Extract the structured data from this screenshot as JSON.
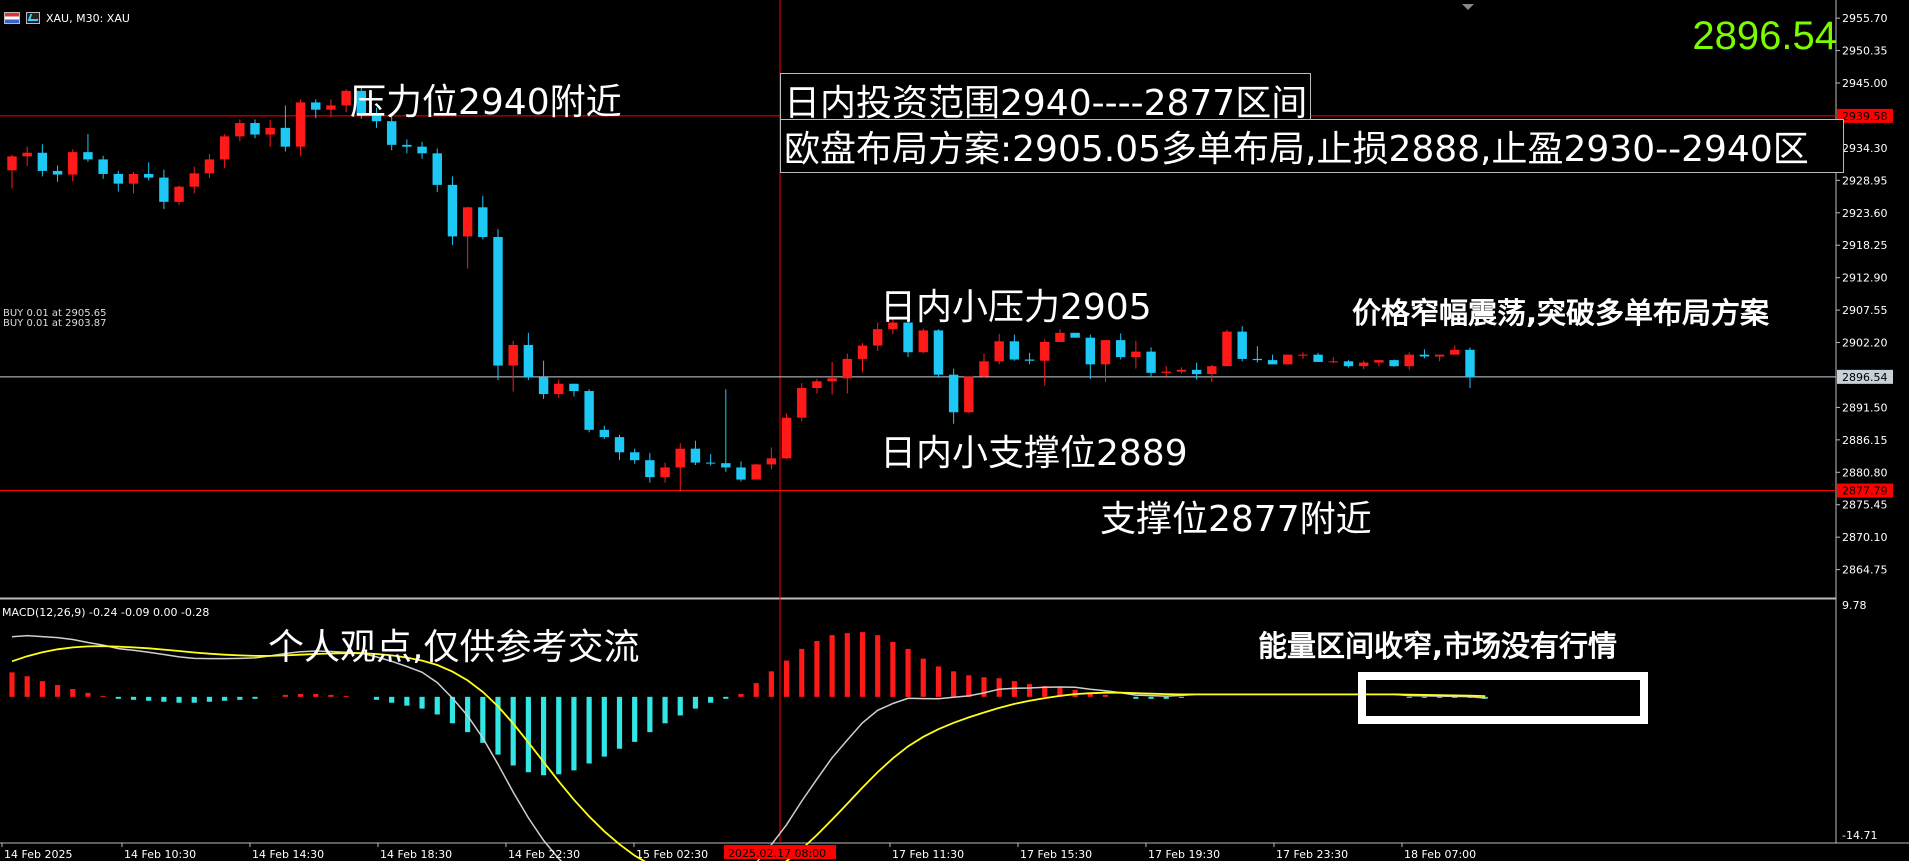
{
  "header": {
    "symbol_text": "XAU, M30:  XAU",
    "icons": [
      "table-icon",
      "chart-icon"
    ]
  },
  "current_price": "2896.54",
  "colors": {
    "background": "#000000",
    "bull_candle": "#ff1a1a",
    "bear_candle": "#1ec8f5",
    "grid_text": "#ffffff",
    "macd_line": "#cfcfcf",
    "signal_line": "#ffff1a",
    "hist_positive": "#ff1a1a",
    "hist_negative": "#33e6e6",
    "level_line": "#ff0000",
    "price_badge": "#c8d0d8",
    "price_big": "#7cfc00"
  },
  "annotations": {
    "resistance": "压力位2940附近",
    "range": "日内投资范围2940----2877区间",
    "plan": "欧盘布局方案:2905.05多单布局,止损2888,止盈2930--2940区",
    "small_resistance": "日内小压力2905",
    "small_support": "日内小支撑位2889",
    "support": "支撑位2877附近",
    "oscillation": "价格窄幅震荡,突破多单布局方案",
    "opinion": "个人观点,仅供参考交流",
    "energy": "能量区间收窄,市场没有行情"
  },
  "trades": [
    "BUY 0.01 at 2905.65",
    "BUY 0.01 at 2903.87"
  ],
  "macd": {
    "label": "MACD(12,26,9) -0.24 -0.09 0.00 -0.28",
    "axis_max": "9.78",
    "axis_min": "-14.71"
  },
  "chart_data": {
    "type": "candlestick",
    "title": "XAU, M30",
    "ylim": [
      2860.4,
      2957.7
    ],
    "price_ticks": [
      "2955.70",
      "2950.35",
      "2945.00",
      "2934.30",
      "2928.95",
      "2923.60",
      "2918.25",
      "2912.90",
      "2907.55",
      "2902.20",
      "2891.50",
      "2886.15",
      "2880.80",
      "2875.45",
      "2870.10",
      "2864.75"
    ],
    "levels": [
      {
        "price": 2939.58,
        "label": "2939.58",
        "color": "#ff0000"
      },
      {
        "price": 2896.54,
        "label": "2896.54",
        "color": "#c8d0d8"
      },
      {
        "price": 2877.79,
        "label": "2877.79",
        "color": "#ff0000"
      }
    ],
    "x_labels": [
      "14 Feb 2025",
      "14 Feb 10:30",
      "14 Feb 14:30",
      "14 Feb 18:30",
      "14 Feb 22:30",
      "15 Feb 02:30",
      "2025.02.17 08:00",
      "17 Feb 11:30",
      "17 Feb 15:30",
      "17 Feb 19:30",
      "17 Feb 23:30",
      "18 Feb 07:00"
    ],
    "candles": [
      [
        2930.6,
        2933.2,
        2927.6,
        2932.9
      ],
      [
        2932.9,
        2934.5,
        2931.3,
        2933.5
      ],
      [
        2933.5,
        2934.9,
        2929.6,
        2930.5
      ],
      [
        2930.5,
        2931.4,
        2928.7,
        2929.9
      ],
      [
        2929.9,
        2934.1,
        2928.8,
        2933.6
      ],
      [
        2933.6,
        2936.6,
        2932.0,
        2932.4
      ],
      [
        2932.4,
        2933.0,
        2929.2,
        2930.0
      ],
      [
        2930.0,
        2930.5,
        2927.1,
        2928.4
      ],
      [
        2928.4,
        2930.3,
        2926.8,
        2930.0
      ],
      [
        2930.0,
        2931.9,
        2928.9,
        2929.4
      ],
      [
        2929.4,
        2930.7,
        2924.2,
        2925.4
      ],
      [
        2925.4,
        2928.1,
        2924.9,
        2927.9
      ],
      [
        2927.9,
        2931.2,
        2926.8,
        2930.1
      ],
      [
        2930.1,
        2933.3,
        2929.3,
        2932.4
      ],
      [
        2932.4,
        2936.6,
        2931.0,
        2936.2
      ],
      [
        2936.2,
        2939.0,
        2935.4,
        2938.4
      ],
      [
        2938.4,
        2939.0,
        2935.9,
        2936.5
      ],
      [
        2936.5,
        2938.9,
        2934.5,
        2937.6
      ],
      [
        2937.6,
        2941.3,
        2933.7,
        2934.5
      ],
      [
        2934.5,
        2942.3,
        2933.0,
        2941.8
      ],
      [
        2941.8,
        2942.3,
        2939.2,
        2940.6
      ],
      [
        2940.6,
        2942.3,
        2939.4,
        2941.3
      ],
      [
        2941.3,
        2944.0,
        2940.2,
        2943.7
      ],
      [
        2943.7,
        2944.3,
        2939.1,
        2939.7
      ],
      [
        2939.7,
        2940.9,
        2937.6,
        2938.7
      ],
      [
        2938.7,
        2939.6,
        2933.9,
        2934.8
      ],
      [
        2934.8,
        2935.7,
        2933.4,
        2934.5
      ],
      [
        2934.5,
        2935.3,
        2932.5,
        2933.4
      ],
      [
        2933.4,
        2934.2,
        2927.0,
        2928.2
      ],
      [
        2928.2,
        2929.6,
        2918.3,
        2919.7
      ],
      [
        2919.7,
        2924.6,
        2914.4,
        2924.5
      ],
      [
        2924.5,
        2926.4,
        2919.2,
        2919.6
      ],
      [
        2919.6,
        2920.9,
        2896.0,
        2898.4
      ],
      [
        2898.4,
        2902.5,
        2894.1,
        2901.8
      ],
      [
        2901.8,
        2903.8,
        2896.0,
        2896.5
      ],
      [
        2896.5,
        2899.2,
        2892.9,
        2893.7
      ],
      [
        2893.7,
        2896.1,
        2893.1,
        2895.4
      ],
      [
        2895.4,
        2895.4,
        2893.3,
        2894.2
      ],
      [
        2894.2,
        2894.5,
        2887.4,
        2887.8
      ],
      [
        2887.8,
        2888.5,
        2886.3,
        2886.6
      ],
      [
        2886.6,
        2887.0,
        2882.8,
        2884.1
      ],
      [
        2884.1,
        2884.7,
        2882.2,
        2882.8
      ],
      [
        2882.8,
        2884.0,
        2879.1,
        2880.0
      ],
      [
        2880.0,
        2882.4,
        2879.1,
        2881.6
      ],
      [
        2881.6,
        2885.6,
        2877.6,
        2884.7
      ],
      [
        2884.7,
        2886.0,
        2882.0,
        2882.4
      ],
      [
        2882.4,
        2883.8,
        2881.9,
        2882.3
      ],
      [
        2882.3,
        2894.5,
        2880.9,
        2881.6
      ],
      [
        2881.6,
        2882.6,
        2879.3,
        2879.6
      ],
      [
        2879.6,
        2882.2,
        2879.6,
        2882.1
      ],
      [
        2882.1,
        2884.9,
        2881.3,
        2883.1
      ],
      [
        2883.1,
        2890.5,
        2883.0,
        2889.8
      ],
      [
        2889.8,
        2895.5,
        2889.2,
        2894.7
      ],
      [
        2894.7,
        2896.2,
        2893.8,
        2895.8
      ],
      [
        2895.8,
        2899.0,
        2893.6,
        2896.3
      ],
      [
        2896.3,
        2900.4,
        2893.8,
        2899.5
      ],
      [
        2899.5,
        2902.1,
        2897.3,
        2901.7
      ],
      [
        2901.7,
        2905.5,
        2900.8,
        2904.4
      ],
      [
        2904.4,
        2906.0,
        2903.6,
        2905.5
      ],
      [
        2905.5,
        2906.5,
        2899.8,
        2900.6
      ],
      [
        2900.6,
        2904.5,
        2900.4,
        2904.2
      ],
      [
        2904.2,
        2904.4,
        2896.4,
        2896.9
      ],
      [
        2896.9,
        2897.9,
        2888.8,
        2890.7
      ],
      [
        2890.7,
        2896.6,
        2890.6,
        2896.6
      ],
      [
        2896.6,
        2900.4,
        2896.5,
        2899.1
      ],
      [
        2899.1,
        2903.6,
        2898.6,
        2902.4
      ],
      [
        2902.4,
        2903.5,
        2899.2,
        2899.4
      ],
      [
        2899.4,
        2900.5,
        2898.6,
        2899.2
      ],
      [
        2899.2,
        2902.7,
        2895.1,
        2902.3
      ],
      [
        2902.3,
        2904.4,
        2902.3,
        2903.8
      ],
      [
        2903.8,
        2903.8,
        2903.0,
        2903.0
      ],
      [
        2903.0,
        2903.5,
        2896.2,
        2898.6
      ],
      [
        2898.6,
        2902.6,
        2895.7,
        2902.6
      ],
      [
        2902.6,
        2903.7,
        2899.4,
        2899.8
      ],
      [
        2899.8,
        2902.5,
        2897.9,
        2900.7
      ],
      [
        2900.7,
        2901.4,
        2896.5,
        2897.2
      ],
      [
        2897.2,
        2898.3,
        2896.6,
        2897.4
      ],
      [
        2897.4,
        2898.1,
        2897.1,
        2897.7
      ],
      [
        2897.7,
        2898.9,
        2896.1,
        2897.0
      ],
      [
        2897.0,
        2898.5,
        2895.7,
        2898.3
      ],
      [
        2898.3,
        2904.3,
        2898.3,
        2904.0
      ],
      [
        2904.0,
        2904.9,
        2899.1,
        2899.5
      ],
      [
        2899.5,
        2901.6,
        2898.9,
        2899.3
      ],
      [
        2899.3,
        2900.2,
        2898.6,
        2898.6
      ],
      [
        2898.6,
        2900.2,
        2898.6,
        2900.2
      ],
      [
        2900.2,
        2900.6,
        2899.5,
        2900.2
      ],
      [
        2900.2,
        2900.5,
        2899.0,
        2899.0
      ],
      [
        2899.0,
        2899.8,
        2898.8,
        2899.1
      ],
      [
        2899.1,
        2899.3,
        2898.1,
        2898.3
      ],
      [
        2898.3,
        2899.2,
        2897.8,
        2898.9
      ],
      [
        2898.9,
        2899.3,
        2898.3,
        2899.3
      ],
      [
        2899.3,
        2899.4,
        2898.2,
        2898.3
      ],
      [
        2898.3,
        2900.6,
        2897.7,
        2900.2
      ],
      [
        2900.2,
        2901.1,
        2899.6,
        2899.9
      ],
      [
        2899.9,
        2900.2,
        2899.1,
        2900.2
      ],
      [
        2900.2,
        2901.7,
        2900.2,
        2901.0
      ],
      [
        2901.0,
        2901.4,
        2894.7,
        2896.5
      ]
    ],
    "macd_hist": [
      2.5,
      2.1,
      1.6,
      1.2,
      0.8,
      0.4,
      0.1,
      -0.2,
      -0.3,
      -0.4,
      -0.5,
      -0.6,
      -0.6,
      -0.5,
      -0.4,
      -0.3,
      -0.2,
      0.0,
      0.2,
      0.3,
      0.3,
      0.2,
      0.1,
      0.0,
      -0.3,
      -0.6,
      -0.9,
      -1.2,
      -1.8,
      -2.7,
      -3.6,
      -4.7,
      -5.9,
      -7.0,
      -7.7,
      -8.0,
      -7.9,
      -7.5,
      -6.8,
      -6.1,
      -5.3,
      -4.6,
      -3.6,
      -2.7,
      -1.9,
      -1.2,
      -0.6,
      -0.2,
      0.3,
      1.4,
      2.6,
      3.7,
      4.9,
      5.7,
      6.3,
      6.5,
      6.6,
      6.3,
      5.6,
      4.9,
      3.9,
      3.1,
      2.6,
      2.2,
      2.0,
      1.9,
      1.6,
      1.3,
      1.1,
      0.9,
      0.7,
      0.4,
      0.2,
      0.0,
      -0.2,
      -0.2,
      -0.2,
      -0.1,
      0.0,
      0.0,
      0.0,
      0.0,
      0.0,
      0.0,
      0.0,
      0.0,
      0.0,
      0.0,
      0.0,
      0.0,
      0.0,
      0.0,
      -0.1,
      -0.1,
      -0.1,
      -0.1,
      -0.1,
      -0.2
    ],
    "macd_line_start": 3.4,
    "signal_line_start": 3.0
  }
}
